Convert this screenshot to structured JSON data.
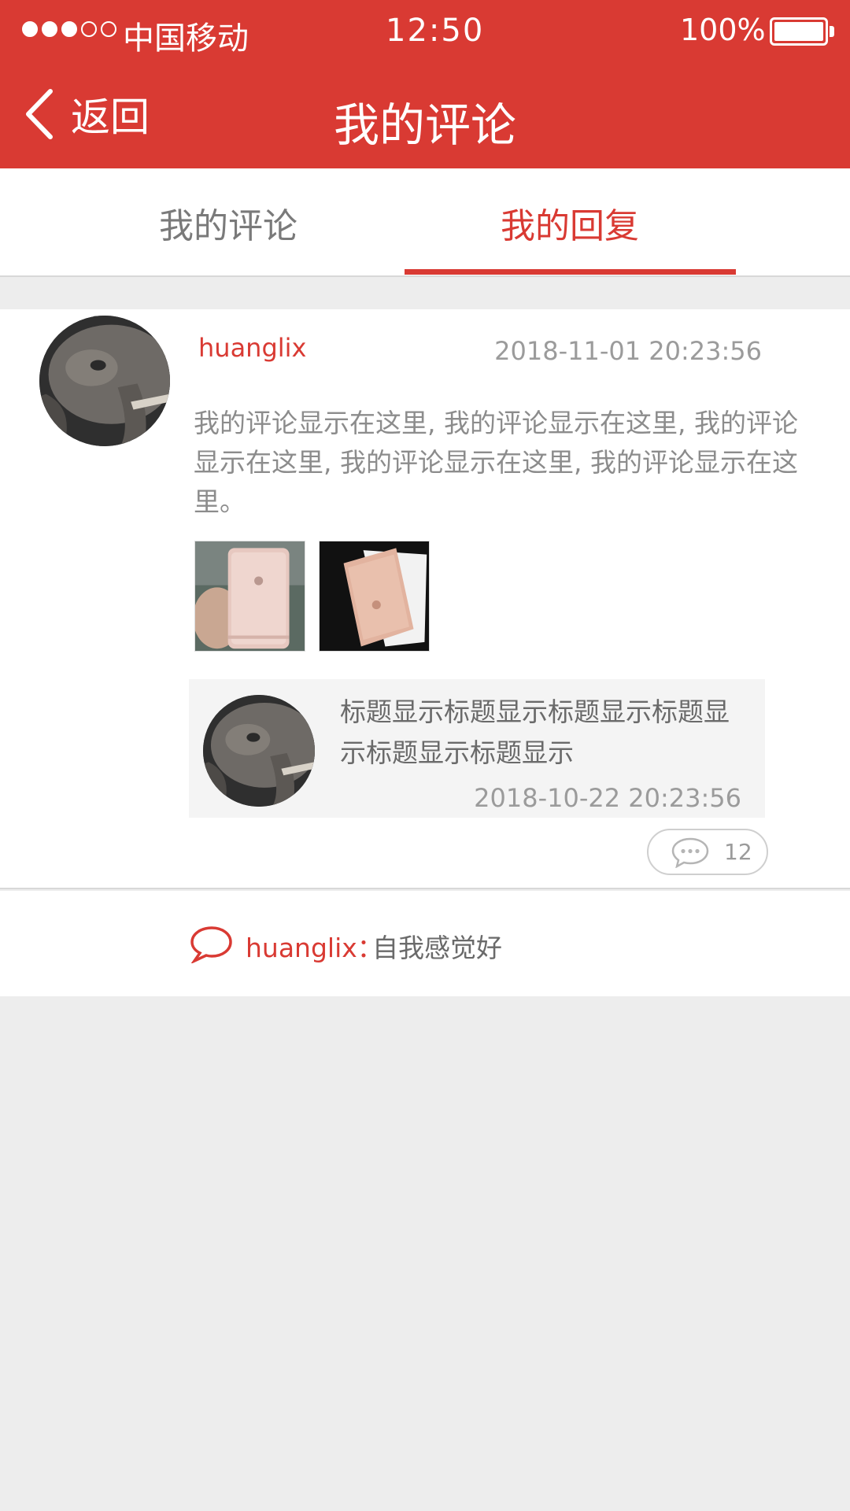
{
  "status_bar": {
    "signal_filled": 3,
    "signal_total": 5,
    "carrier": "中国移动",
    "time": "12:50",
    "battery": "100%"
  },
  "nav": {
    "back_label": "返回",
    "title": "我的评论",
    "back_icon": "chevron-left-icon"
  },
  "tabs": [
    {
      "label": "我的评论",
      "active": false
    },
    {
      "label": "我的回复",
      "active": true
    }
  ],
  "comment": {
    "username": "huanglix",
    "time": "2018-11-01 20:23:56",
    "text": "我的评论显示在这里, 我的评论显示在这里, 我的评论显示在这里, 我的评论显示在这里, 我的评论显示在这里。",
    "quoted": {
      "title": "标题显示标题显示标题显示标题显示标题显示标题显示",
      "time": "2018-10-22 20:23:56"
    },
    "reply_count": "12",
    "reply": {
      "user": "huanglix：",
      "text": "自我感觉好"
    }
  },
  "colors": {
    "accent": "#d93a33",
    "muted_text": "#9b9b9b",
    "background": "#ededed"
  }
}
